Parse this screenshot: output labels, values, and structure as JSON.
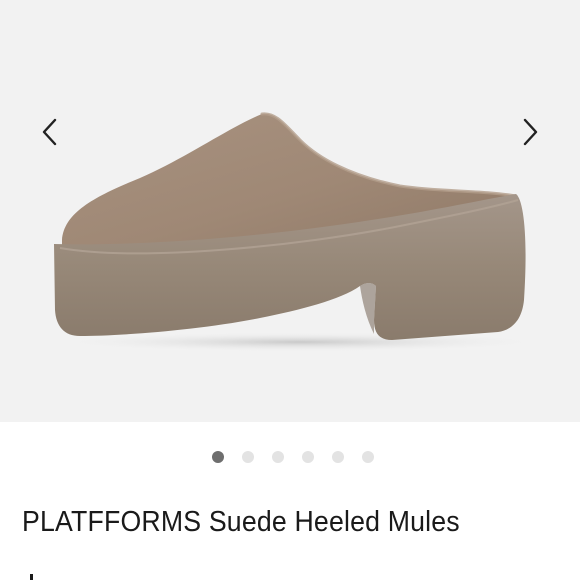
{
  "gallery": {
    "prev_icon": "chevron-left-icon",
    "next_icon": "chevron-right-icon",
    "image": "suede-platform-mule-photo",
    "slide_count": 6,
    "active_slide": 1
  },
  "product": {
    "title": "PLATFFORMS Suede Heeled Mules"
  },
  "colors": {
    "gallery_bg": "#f2f2f2",
    "suede": "#a08976",
    "sole": "#998a7b",
    "dot_active": "#6e6e6e",
    "dot_inactive": "#e3e3e3"
  }
}
